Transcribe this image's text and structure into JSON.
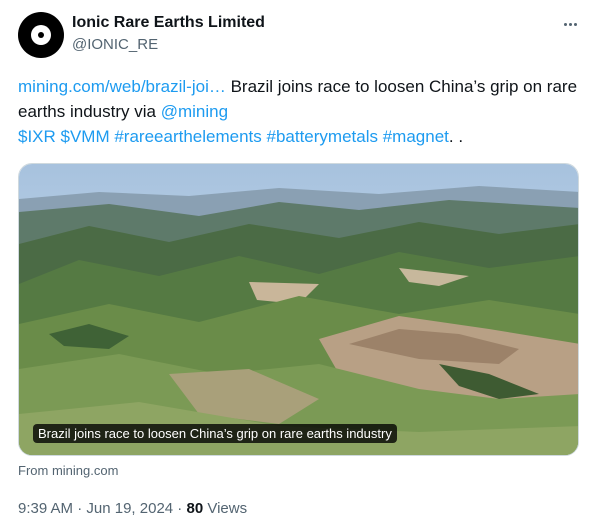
{
  "author": {
    "name": "Ionic Rare Earths Limited",
    "handle": "@IONIC_RE"
  },
  "tweet": {
    "link_text": "mining.com/web/brazil-joi…",
    "text_part1": " Brazil joins race to loosen China’s grip on rare earths industry via ",
    "mention": "@mining",
    "cashtags": "$IXR $VMM #rareearthelements #batterymetals #magnet",
    "trailing": ".  ."
  },
  "card": {
    "caption": "Brazil joins race to loosen China’s grip on rare earths industry",
    "source": "From mining.com"
  },
  "meta": {
    "time": "9:39 AM",
    "sep1": " · ",
    "date": "Jun 19, 2024",
    "sep2": " · ",
    "views_count": "80",
    "views_label": " Views"
  }
}
